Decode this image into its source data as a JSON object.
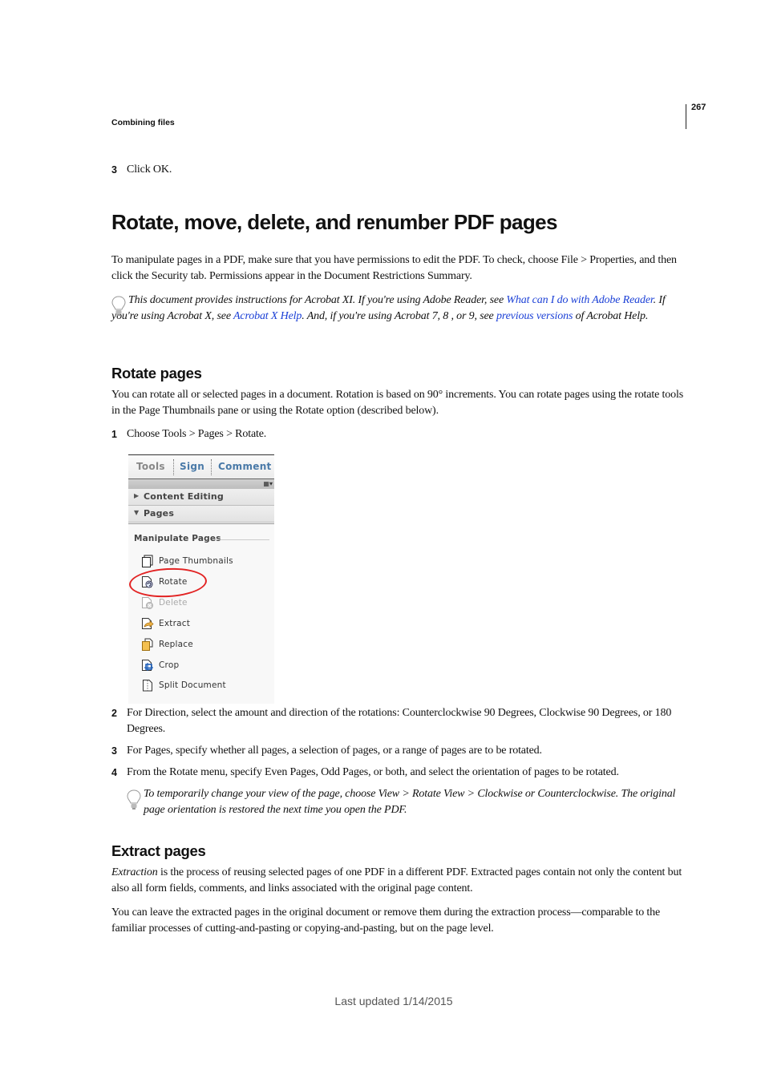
{
  "header": {
    "page_number": "267",
    "running_head": "Combining files"
  },
  "prev_step": {
    "number": "3",
    "text": "Click OK."
  },
  "title": "Rotate, move, delete, and renumber PDF pages",
  "intro": "To manipulate pages in a PDF, make sure that you have permissions to edit the PDF. To check, choose File > Properties, and then click the Security tab. Permissions appear in the Document Restrictions Summary.",
  "note1": {
    "icon": "lightbulb-icon",
    "t1": "This document provides instructions for Acrobat XI. If you're using Adobe Reader, see ",
    "link1": "What can I do with Adobe Reader",
    "t2": ". If you're using Acrobat X, see ",
    "link2": "Acrobat X Help",
    "t3": ". And, if you're using Acrobat 7, 8 , or 9, see ",
    "link3": "previous versions",
    "t4": " of Acrobat Help.",
    "link_color": "#1a3fd6"
  },
  "rotate_section": {
    "heading": "Rotate pages",
    "para": "You can rotate all or selected pages in a document. Rotation is based on 90° increments. You can rotate pages using the rotate tools in the Page Thumbnails pane or using the Rotate option (described below).",
    "steps": [
      {
        "number": "1",
        "text": "Choose Tools > Pages > Rotate."
      },
      {
        "number": "2",
        "text": "For Direction, select the amount and direction of the rotations: Counterclockwise 90 Degrees, Clockwise 90 Degrees, or 180 Degrees."
      },
      {
        "number": "3",
        "text": "For Pages, specify whether all pages, a selection of pages, or a range of pages are to be rotated."
      },
      {
        "number": "4",
        "text": "From the Rotate menu, specify Even Pages, Odd Pages, or both, and select the orientation of pages to be rotated."
      }
    ],
    "note": {
      "icon": "lightbulb-icon",
      "text": "To temporarily change your view of the page, choose View > Rotate View > Clockwise or Counterclockwise. The original page orientation is restored the next time you open the PDF."
    }
  },
  "tools_pane": {
    "tabs": [
      "Tools",
      "Sign",
      "Comment"
    ],
    "panel_menu_icon": "panel-options-icon",
    "sections": [
      {
        "label": "Content Editing",
        "state": "collapsed"
      },
      {
        "label": "Pages",
        "state": "expanded"
      }
    ],
    "group_title": "Manipulate Pages",
    "items": [
      {
        "label": "Page Thumbnails",
        "icon": "page-thumbnails-icon",
        "enabled": true
      },
      {
        "label": "Rotate",
        "icon": "rotate-icon",
        "enabled": true,
        "highlighted": true
      },
      {
        "label": "Delete",
        "icon": "delete-page-icon",
        "enabled": false
      },
      {
        "label": "Extract",
        "icon": "extract-icon",
        "enabled": true
      },
      {
        "label": "Replace",
        "icon": "replace-icon",
        "enabled": true
      },
      {
        "label": "Crop",
        "icon": "crop-icon",
        "enabled": true
      },
      {
        "label": "Split Document",
        "icon": "split-document-icon",
        "enabled": true
      }
    ],
    "highlight_color": "#e22323"
  },
  "extract_section": {
    "heading": "Extract pages",
    "para1_em": "Extraction",
    "para1_rest": " is the process of reusing selected pages of one PDF in a different PDF. Extracted pages contain not only the content but also all form fields, comments, and links associated with the original page content.",
    "para2": "You can leave the extracted pages in the original document or remove them during the extraction process—comparable to the familiar processes of cutting-and-pasting or copying-and-pasting, but on the page level."
  },
  "footer": "Last updated 1/14/2015"
}
